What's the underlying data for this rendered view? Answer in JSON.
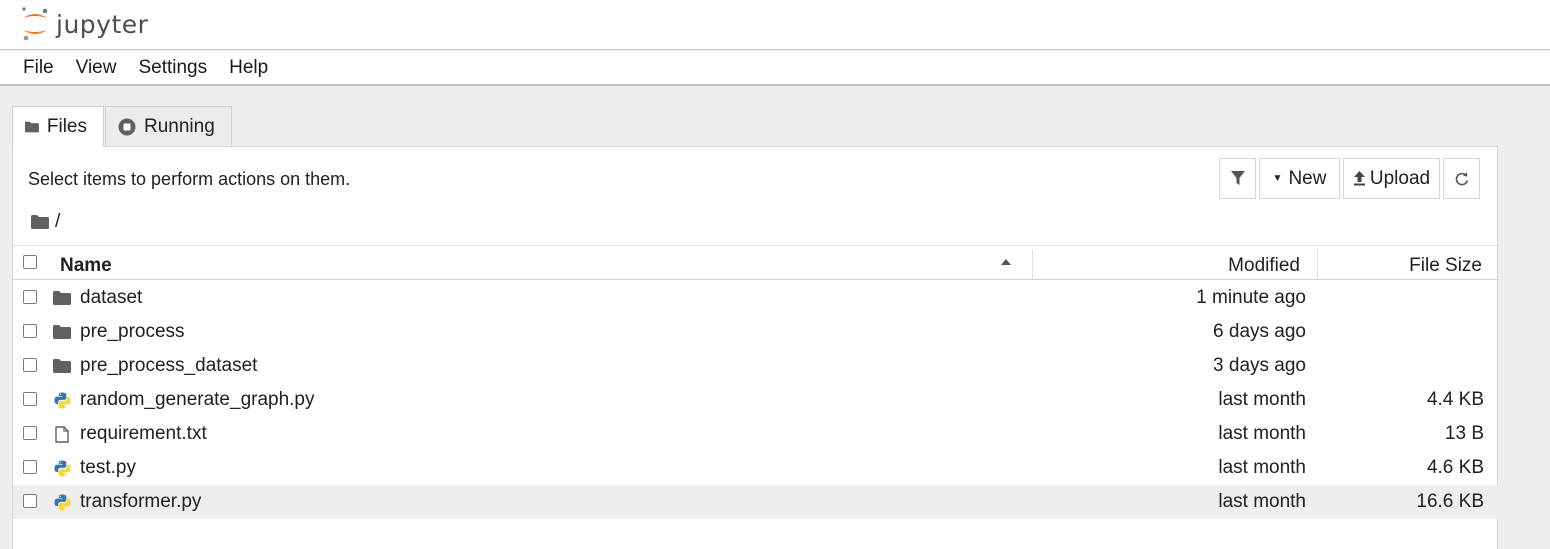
{
  "app": {
    "logo_text": "jupyter"
  },
  "menu": {
    "items": [
      "File",
      "View",
      "Settings",
      "Help"
    ]
  },
  "tabs": [
    {
      "label": "Files",
      "icon": "folder-icon",
      "active": true
    },
    {
      "label": "Running",
      "icon": "stop-circle-icon",
      "active": false
    }
  ],
  "browser": {
    "hint": "Select items to perform actions on them.",
    "breadcrumb": "/",
    "toolbar": {
      "new_label": "New",
      "upload_label": "Upload"
    },
    "columns": {
      "name": "Name",
      "modified": "Modified",
      "size": "File Size"
    },
    "files": [
      {
        "name": "dataset",
        "type": "folder",
        "modified": "1 minute ago",
        "size": ""
      },
      {
        "name": "pre_process",
        "type": "folder",
        "modified": "6 days ago",
        "size": ""
      },
      {
        "name": "pre_process_dataset",
        "type": "folder",
        "modified": "3 days ago",
        "size": ""
      },
      {
        "name": "random_generate_graph.py",
        "type": "python",
        "modified": "last month",
        "size": "4.4 KB"
      },
      {
        "name": "requirement.txt",
        "type": "text",
        "modified": "last month",
        "size": "13 B"
      },
      {
        "name": "test.py",
        "type": "python",
        "modified": "last month",
        "size": "4.6 KB"
      },
      {
        "name": "transformer.py",
        "type": "python",
        "modified": "last month",
        "size": "16.6 KB"
      }
    ]
  },
  "colors": {
    "accent_orange": "#F37726",
    "folder_gray": "#616161",
    "python_blue": "#3776AB",
    "python_yellow": "#FFD43B"
  }
}
